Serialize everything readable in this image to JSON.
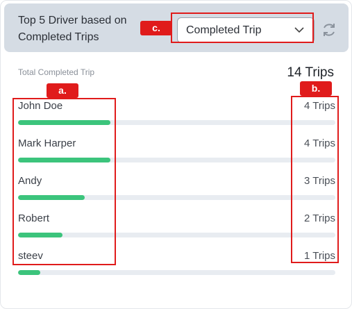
{
  "header": {
    "title": "Top 5 Driver based on Completed Trips",
    "dropdown_value": "Completed Trip"
  },
  "summary": {
    "label": "Total Completed Trip",
    "value": "14 Trips"
  },
  "annotations": {
    "a": "a.",
    "b": "b.",
    "c": "c."
  },
  "drivers": [
    {
      "name": "John Doe",
      "trips_label": "4 Trips",
      "progress": 0.29
    },
    {
      "name": "Mark Harper",
      "trips_label": "4 Trips",
      "progress": 0.29
    },
    {
      "name": "Andy",
      "trips_label": "3 Trips",
      "progress": 0.21
    },
    {
      "name": "Robert",
      "trips_label": "2 Trips",
      "progress": 0.14
    },
    {
      "name": "steev",
      "trips_label": "1 Trips",
      "progress": 0.07
    }
  ],
  "colors": {
    "progress_fill": "#3cc47c",
    "track": "#e8ecf1",
    "annotation": "#e01b1b",
    "header_bg": "#d5dce4"
  },
  "icons": {
    "dropdown": "chevron-down-icon",
    "refresh": "refresh-icon"
  }
}
